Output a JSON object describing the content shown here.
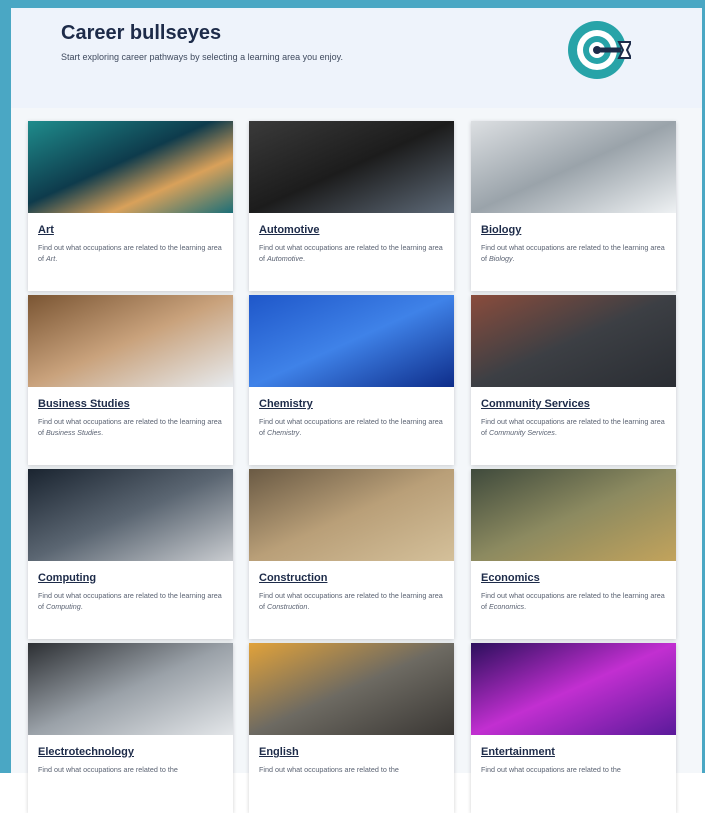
{
  "header": {
    "title": "Career bullseyes",
    "subtitle": "Start exploring career pathways by selecting a learning area you enjoy.",
    "logo_icon": "bullseye-arrow-icon"
  },
  "cards": [
    {
      "name": "Art",
      "desc_prefix": "Find out what occupations are related to the learning area of ",
      "desc_area": "Art",
      "desc_suffix": "."
    },
    {
      "name": "Automotive",
      "desc_prefix": "Find out what occupations are related to the learning area of ",
      "desc_area": "Automotive",
      "desc_suffix": "."
    },
    {
      "name": "Biology",
      "desc_prefix": "Find out what occupations are related to the learning area of ",
      "desc_area": "Biology",
      "desc_suffix": "."
    },
    {
      "name": "Business Studies",
      "desc_prefix": "Find out what occupations are related to the learning area of ",
      "desc_area": "Business Studies",
      "desc_suffix": "."
    },
    {
      "name": "Chemistry",
      "desc_prefix": "Find out what occupations are related to the learning area of ",
      "desc_area": "Chemistry",
      "desc_suffix": "."
    },
    {
      "name": "Community Services",
      "desc_prefix": "Find out what occupations are related to the learning area of ",
      "desc_area": "Community Services",
      "desc_suffix": "."
    },
    {
      "name": "Computing",
      "desc_prefix": "Find out what occupations are related to the learning area of ",
      "desc_area": "Computing",
      "desc_suffix": "."
    },
    {
      "name": "Construction",
      "desc_prefix": "Find out what occupations are related to the learning area of ",
      "desc_area": "Construction",
      "desc_suffix": "."
    },
    {
      "name": "Economics",
      "desc_prefix": "Find out what occupations are related to the learning area of ",
      "desc_area": "Economics",
      "desc_suffix": "."
    },
    {
      "name": "Electrotechnology",
      "desc_prefix": "Find out what occupations are related to the",
      "desc_area": "",
      "desc_suffix": ""
    },
    {
      "name": "English",
      "desc_prefix": "Find out what occupations are related to the",
      "desc_area": "",
      "desc_suffix": ""
    },
    {
      "name": "Entertainment",
      "desc_prefix": "Find out what occupations are related to the",
      "desc_area": "",
      "desc_suffix": ""
    }
  ],
  "colors": {
    "frame": "#4aa7c4",
    "title": "#1d2b49",
    "logo_teal": "#27a3a8"
  }
}
